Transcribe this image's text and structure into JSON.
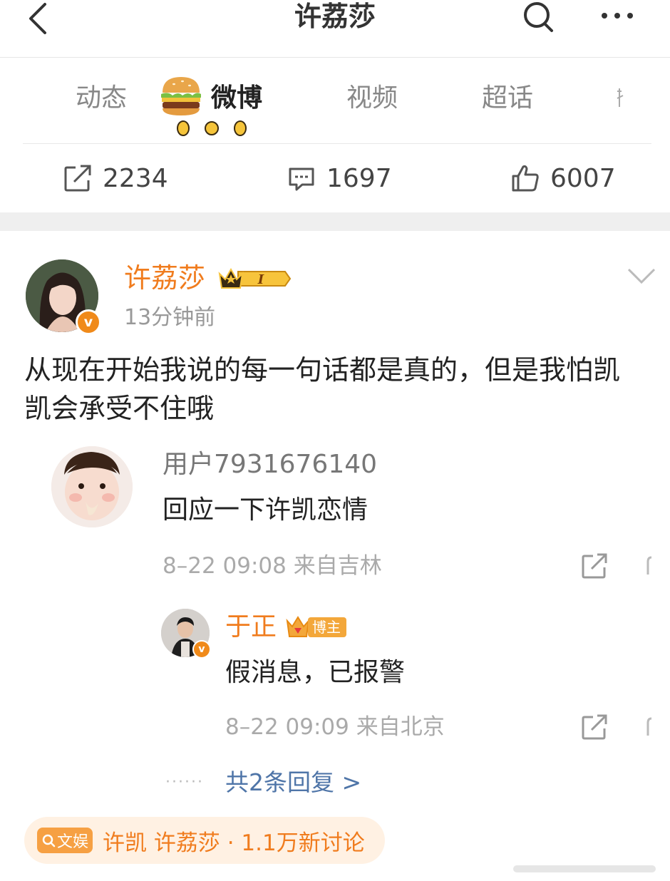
{
  "header": {
    "title": "许荔莎"
  },
  "tabs": [
    {
      "label": "动态"
    },
    {
      "label": "微博"
    },
    {
      "label": "视频"
    },
    {
      "label": "超话"
    }
  ],
  "stats": {
    "reposts": "2234",
    "comments": "1697",
    "likes": "6007"
  },
  "post": {
    "author": "许荔莎",
    "badge_level": "I",
    "time": "13分钟前",
    "content": "从现在开始我说的每一句话都是真的，但是我怕凯凯会承受不住哦"
  },
  "comment": {
    "user": "用户7931676140",
    "text": "回应一下许凯恋情",
    "meta": "8–22 09:08  来自吉林"
  },
  "reply": {
    "user": "于正",
    "badge": "博主",
    "text": "假消息，已报警",
    "meta": "8–22 09:09  来自北京"
  },
  "more_replies": "共2条回复 >",
  "topic": {
    "tag": "文娱",
    "text": "许凯 许荔莎 · 1.1万新讨论"
  },
  "colors": {
    "accent": "#f07c1e",
    "link": "#4f75a8"
  }
}
